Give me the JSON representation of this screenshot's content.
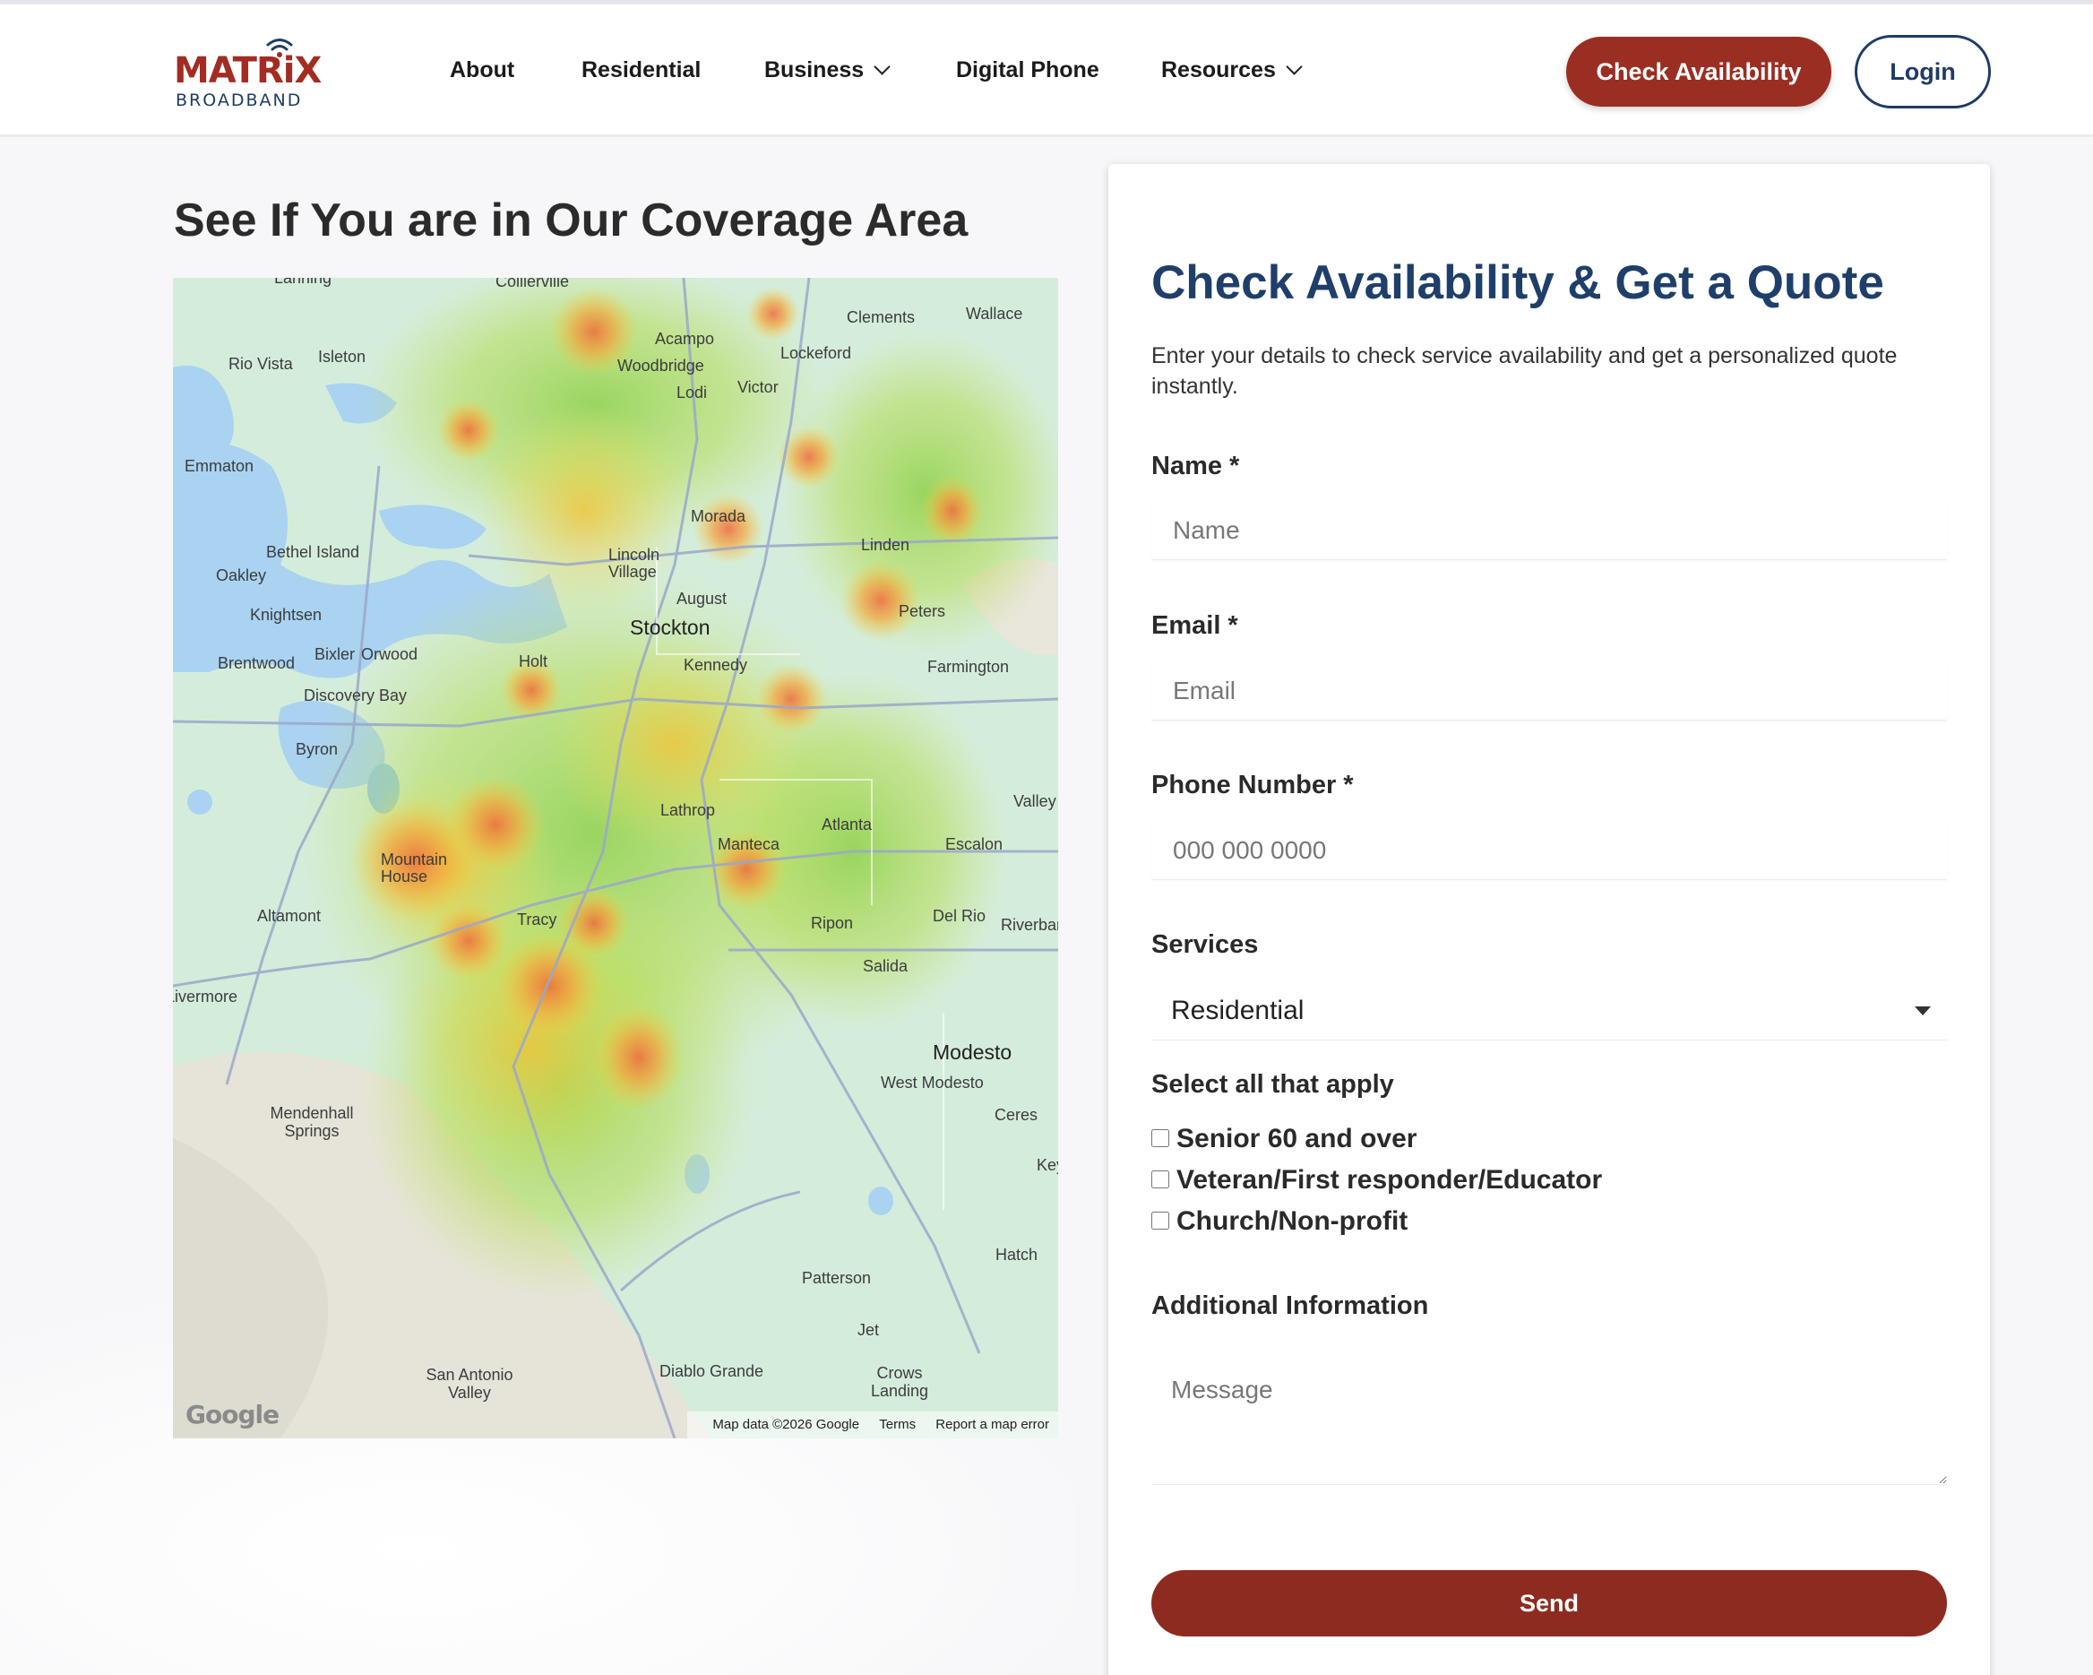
{
  "brand": {
    "name": "MATRiX",
    "tagline": "BROADBAND",
    "primary_color": "#9a2e22",
    "secondary_color": "#1f3c66"
  },
  "nav": {
    "items": [
      {
        "label": "About",
        "dropdown": false
      },
      {
        "label": "Residential",
        "dropdown": false
      },
      {
        "label": "Business",
        "dropdown": true
      },
      {
        "label": "Digital Phone",
        "dropdown": false
      },
      {
        "label": "Resources",
        "dropdown": true
      }
    ],
    "check_availability": "Check Availability",
    "login": "Login"
  },
  "coverage": {
    "title": "See If You are in Our Coverage Area",
    "map": {
      "places": [
        "Lanning",
        "Collierville",
        "Clements",
        "Wallace",
        "Rio Vista",
        "Isleton",
        "Acampo",
        "Woodbridge",
        "Lockeford",
        "Lodi",
        "Victor",
        "Emmaton",
        "Morada",
        "Bethel Island",
        "Oakley",
        "Lincoln Village",
        "Linden",
        "August",
        "Knightsen",
        "Stockton",
        "Peters",
        "Brentwood",
        "Bixler",
        "Orwood",
        "Holt",
        "Kennedy",
        "Farmington",
        "Discovery Bay",
        "Byron",
        "Valley",
        "Lathrop",
        "Atlanta",
        "Manteca",
        "Escalon",
        "Mountain House",
        "Altamont",
        "Tracy",
        "Ripon",
        "Del Rio",
        "Riverbank",
        "Salida",
        "Livermore",
        "Modesto",
        "West Modesto",
        "Mendenhall Springs",
        "Ceres",
        "Keyes",
        "Hatch",
        "Patterson",
        "Jet",
        "San Antonio Valley",
        "Diablo Grande",
        "Crows Landing"
      ],
      "google_logo": "Google",
      "attribution": "Map data ©2026 Google",
      "terms": "Terms",
      "report": "Report a map error"
    }
  },
  "form": {
    "title": "Check Availability & Get a Quote",
    "description": "Enter your details to check service availability and get a personalized quote instantly.",
    "name_label": "Name *",
    "name_placeholder": "Name",
    "email_label": "Email *",
    "email_placeholder": "Email",
    "phone_label": "Phone Number *",
    "phone_placeholder": "000 000 0000",
    "services_label": "Services",
    "services_value": "Residential",
    "select_all_label": "Select all that apply",
    "options": [
      "Senior 60 and over",
      "Veteran/First responder/Educator",
      "Church/Non-profit"
    ],
    "additional_label": "Additional Information",
    "message_placeholder": "Message",
    "send_label": "Send"
  }
}
